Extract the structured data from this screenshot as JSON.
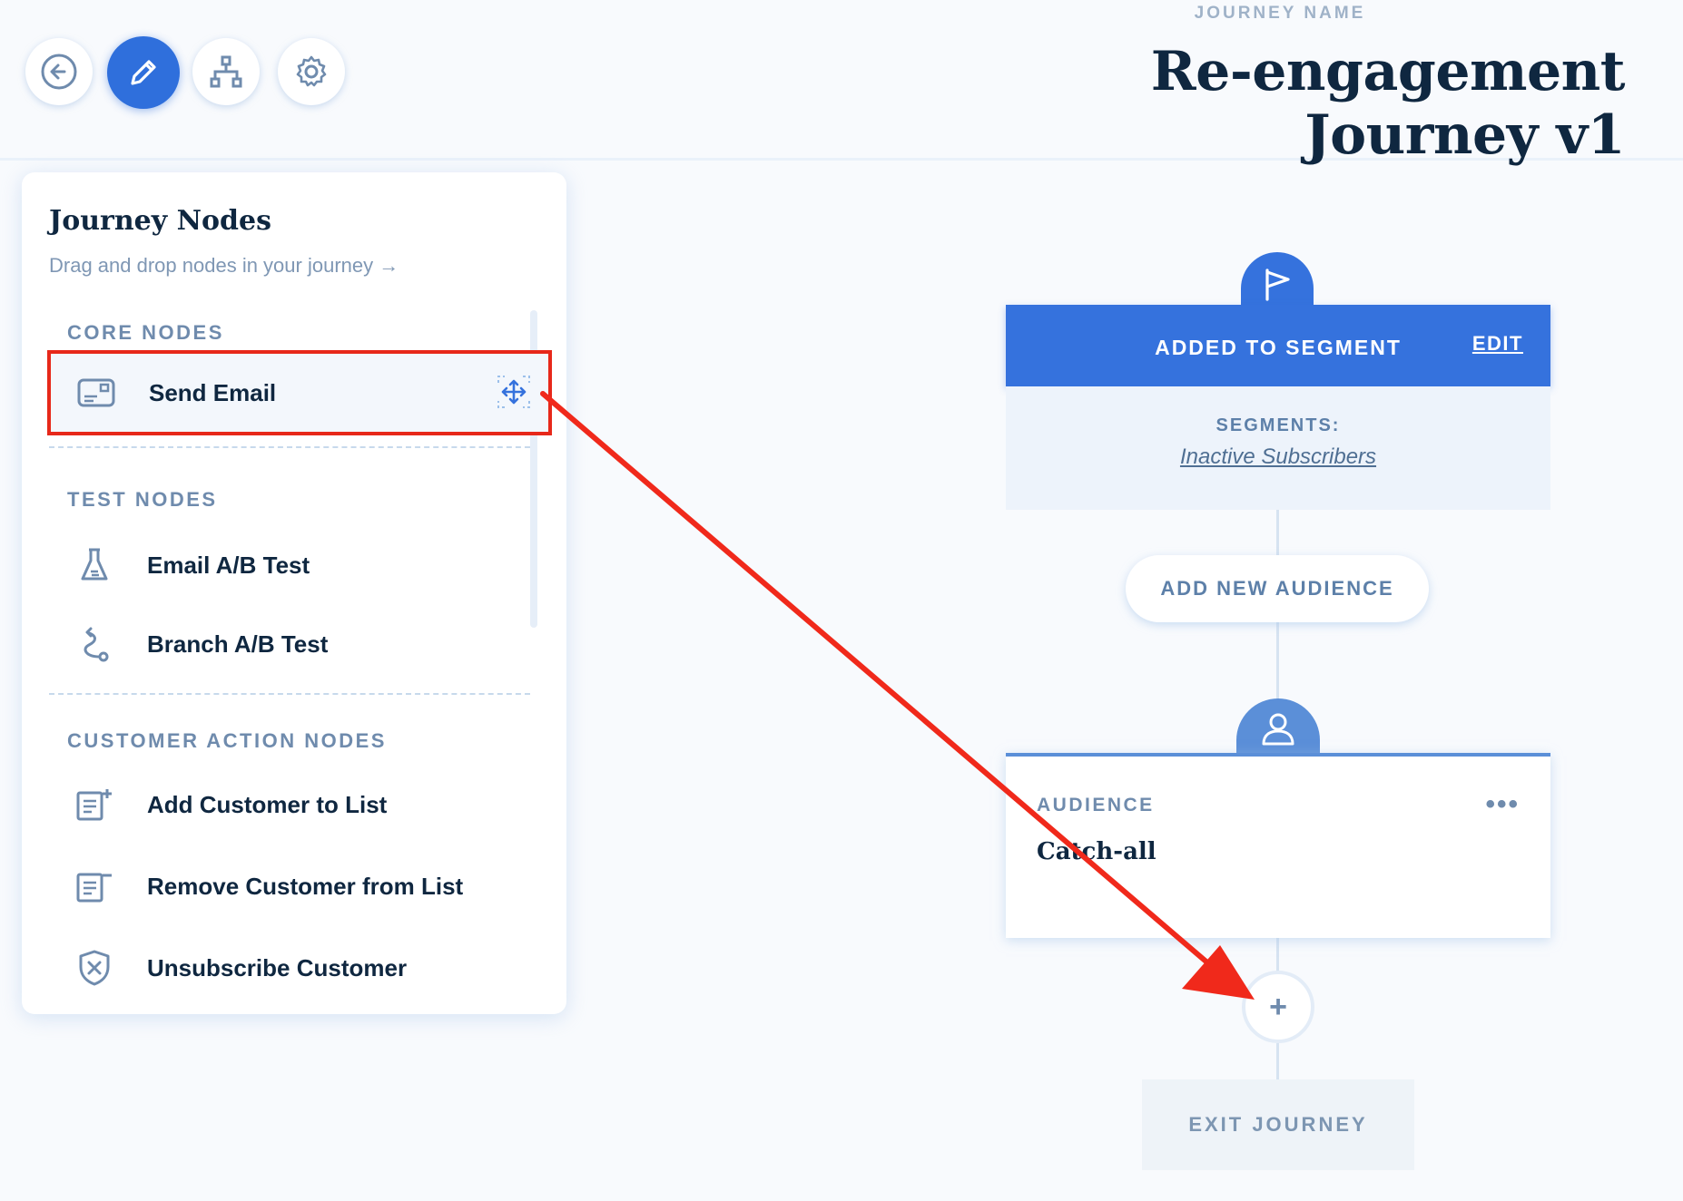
{
  "header": {
    "journey_name_label": "JOURNEY NAME",
    "journey_title": "Re-engagement Journey v1",
    "buttons": [
      {
        "name": "back",
        "icon": "arrow-left-icon"
      },
      {
        "name": "edit",
        "icon": "pencil-icon",
        "active": true
      },
      {
        "name": "structure",
        "icon": "sitemap-icon"
      },
      {
        "name": "settings",
        "icon": "gear-icon"
      }
    ]
  },
  "panel": {
    "title": "Journey Nodes",
    "subtitle": "Drag and drop nodes in your journey →",
    "sections": {
      "core": "CORE NODES",
      "test": "TEST NODES",
      "customer_action": "CUSTOMER ACTION NODES"
    },
    "nodes": {
      "send_email": "Send Email",
      "email_ab_test": "Email A/B Test",
      "branch_ab_test": "Branch A/B Test",
      "add_customer_to_list": "Add Customer to List",
      "remove_customer_from_list": "Remove Customer from List",
      "unsubscribe_customer": "Unsubscribe Customer"
    }
  },
  "canvas": {
    "trigger": {
      "title": "ADDED TO SEGMENT",
      "edit_label": "EDIT",
      "segments_label": "SEGMENTS:",
      "segments_value": "Inactive Subscribers"
    },
    "add_audience_label": "ADD NEW AUDIENCE",
    "audience": {
      "label": "AUDIENCE",
      "name": "Catch-all",
      "more": "•••"
    },
    "plus_label": "+",
    "exit_label": "EXIT JOURNEY"
  },
  "colors": {
    "accent": "#3572dd",
    "highlight_border": "#e7281a",
    "annotation_arrow": "#f0291b"
  }
}
